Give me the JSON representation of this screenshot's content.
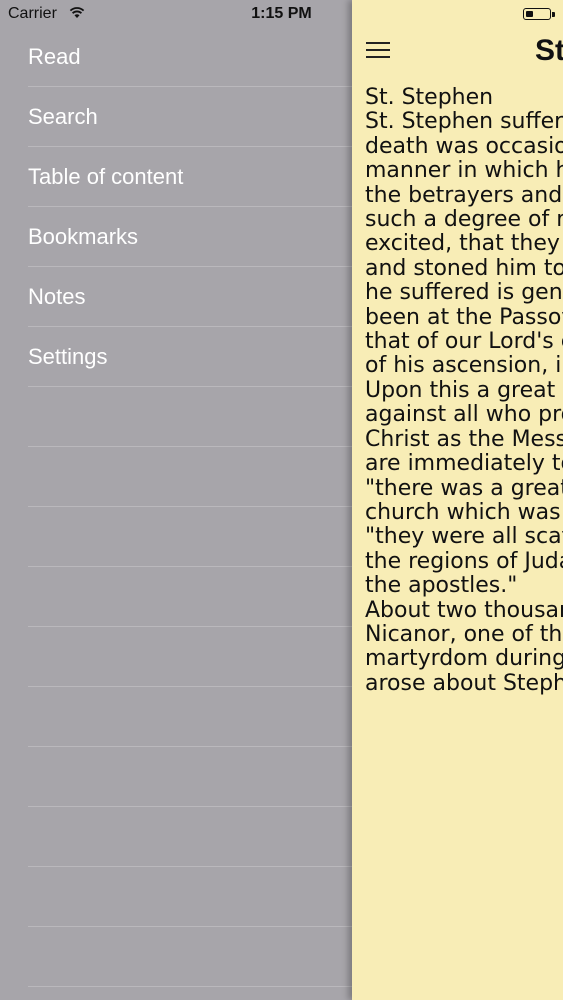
{
  "status_bar": {
    "carrier": "Carrier",
    "time": "1:15 PM",
    "battery_level": 0.3
  },
  "menu": {
    "items": [
      {
        "label": "Read"
      },
      {
        "label": "Search"
      },
      {
        "label": "Table of content"
      },
      {
        "label": "Bookmarks"
      },
      {
        "label": "Notes"
      },
      {
        "label": "Settings"
      }
    ]
  },
  "reader": {
    "title": "St. Stephen",
    "lines": [
      "St. Stephen",
      "St. Stephen suffered martyrdom, the first after",
      "death was occasioned by the faithful",
      "manner in which he preached the gospel to",
      "the betrayers and murderers of Christ. To",
      "such a degree of madness were they",
      "excited, that they cast him out of the city",
      "and stoned him to death. The time when",
      "he suffered is generally supposed to have",
      "been at the Passover which succeeded to",
      "that of our Lord's crucifixion, and to the era",
      "of his ascension, in the following spring.",
      "Upon this a great persecution was raised",
      "against all who professed their belief in",
      "Christ as the Messiah, or as a prophet. We",
      "are immediately told by St. Luke, that",
      "\"there was a great persecution against the",
      "church which was at Jerusalem;\" and that",
      "\"they were all scattered abroad throughout",
      "the regions of Judaea and Samaria, except",
      "the apostles.\"",
      "About two thousand Christians, with",
      "Nicanor, one of the seven deacons, suffered",
      "martyrdom during the \"tribulation that",
      "arose about Stephen.\""
    ]
  }
}
